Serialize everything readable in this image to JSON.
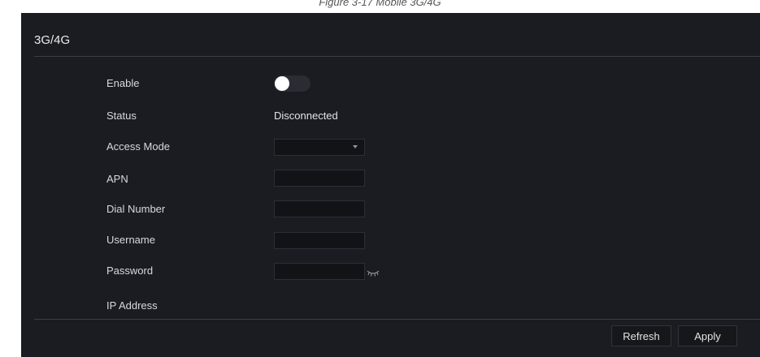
{
  "page_caption": "Figure 3-17 Mobile 3G/4G",
  "section": {
    "title": "3G/4G"
  },
  "form": {
    "enable_label": "Enable",
    "enable_state": "off",
    "status_label": "Status",
    "status_value": "Disconnected",
    "access_mode_label": "Access Mode",
    "access_mode_value": "",
    "apn_label": "APN",
    "apn_value": "",
    "dial_number_label": "Dial Number",
    "dial_number_value": "",
    "username_label": "Username",
    "username_value": "",
    "password_label": "Password",
    "password_value": "",
    "ip_address_label": "IP Address",
    "ip_address_value": ""
  },
  "buttons": {
    "refresh_label": "Refresh",
    "apply_label": "Apply"
  },
  "icons": {
    "password_toggle": "eye-closed-icon",
    "dropdown": "chevron-down-icon"
  },
  "colors": {
    "panel_bg": "#1a1c21",
    "field_bg": "#121317",
    "toggle_knob": "#ffffff",
    "text": "#d8d9dc"
  }
}
